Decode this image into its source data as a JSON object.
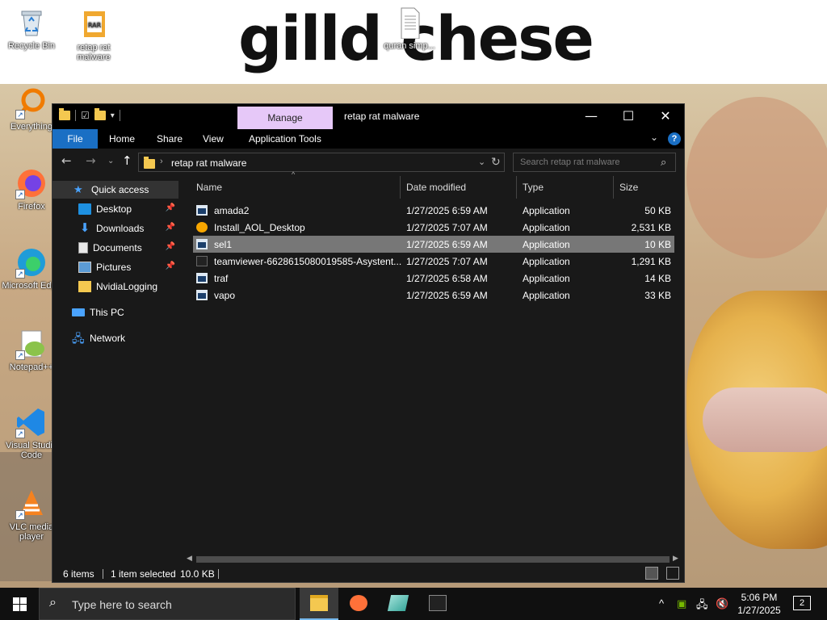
{
  "wallpaper": {
    "title_text": "gilld chese"
  },
  "desktop_icons": [
    {
      "label": "Recycle Bin",
      "icon": "recycle-bin-icon"
    },
    {
      "label": "retap rat malware",
      "icon": "winrar-archive-icon"
    },
    {
      "label": "quran simp...",
      "icon": "text-file-icon"
    },
    {
      "label": "Everything",
      "icon": "everything-search-icon"
    },
    {
      "label": "Firefox",
      "icon": "firefox-icon"
    },
    {
      "label": "Microsoft Edge",
      "icon": "edge-icon"
    },
    {
      "label": "Notepad++",
      "icon": "notepad-plus-plus-icon"
    },
    {
      "label": "Visual Studio Code",
      "icon": "vscode-icon"
    },
    {
      "label": "VLC media player",
      "icon": "vlc-icon"
    }
  ],
  "explorer": {
    "window_title": "retap rat malware",
    "manage_tab": "Manage",
    "ribbon_tabs": [
      "File",
      "Home",
      "Share",
      "View",
      "Application Tools"
    ],
    "address_path": "retap rat malware",
    "search_placeholder": "Search retap rat malware",
    "nav_pane": {
      "quick_access": "Quick access",
      "items": [
        {
          "label": "Desktop",
          "pinned": true
        },
        {
          "label": "Downloads",
          "pinned": true
        },
        {
          "label": "Documents",
          "pinned": true
        },
        {
          "label": "Pictures",
          "pinned": true
        },
        {
          "label": "NvidiaLogging",
          "pinned": false
        }
      ],
      "this_pc": "This PC",
      "network": "Network"
    },
    "columns": [
      "Name",
      "Date modified",
      "Type",
      "Size"
    ],
    "files": [
      {
        "name": "amada2",
        "date": "1/27/2025 6:59 AM",
        "type": "Application",
        "size": "50 KB",
        "icon": "app-icon",
        "selected": false
      },
      {
        "name": "Install_AOL_Desktop",
        "date": "1/27/2025 7:07 AM",
        "type": "Application",
        "size": "2,531 KB",
        "icon": "aol-icon",
        "selected": false
      },
      {
        "name": "sel1",
        "date": "1/27/2025 6:59 AM",
        "type": "Application",
        "size": "10 KB",
        "icon": "app-icon",
        "selected": true
      },
      {
        "name": "teamviewer-6628615080019585-Asystent...",
        "date": "1/27/2025 7:07 AM",
        "type": "Application",
        "size": "1,291 KB",
        "icon": "teamviewer-icon",
        "selected": false
      },
      {
        "name": "traf",
        "date": "1/27/2025 6:58 AM",
        "type": "Application",
        "size": "14 KB",
        "icon": "app-icon",
        "selected": false
      },
      {
        "name": "vapo",
        "date": "1/27/2025 6:59 AM",
        "type": "Application",
        "size": "33 KB",
        "icon": "app-icon",
        "selected": false
      }
    ],
    "status": {
      "items": "6 items",
      "selected": "1 item selected",
      "size": "10.0 KB"
    }
  },
  "taskbar": {
    "search_placeholder": "Type here to search",
    "time": "5:06 PM",
    "date": "1/27/2025",
    "notifications": "2"
  }
}
